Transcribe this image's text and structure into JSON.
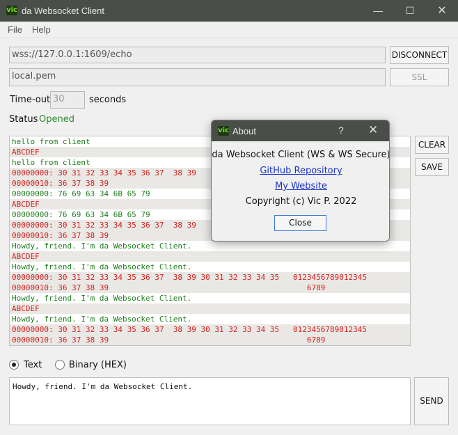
{
  "window": {
    "title": "da Websocket Client",
    "icon_text": "vic",
    "controls": {
      "minimize": "—",
      "maximize": "☐",
      "close": "✕"
    }
  },
  "menu": {
    "file": "File",
    "help": "Help"
  },
  "connection": {
    "url_value": "wss://127.0.0.1:1609/echo",
    "disconnect_label": "DISCONNECT",
    "cert_value": "local.pem",
    "ssl_label": "SSL",
    "timeout_label": "Time-out",
    "timeout_placeholder": "30",
    "seconds_label": "seconds",
    "status_label": "Status",
    "status_value": "Opened"
  },
  "log": [
    {
      "text": "hello from client",
      "kind": "green"
    },
    {
      "text": "ABCDEF",
      "kind": "red"
    },
    {
      "text": "hello from client",
      "kind": "green"
    },
    {
      "text": "00000000: 30 31 32 33 34 35 36 37  38 39",
      "kind": "red"
    },
    {
      "text": "00000010: 36 37 38 39",
      "kind": "red"
    },
    {
      "text": "00000000: 76 69 63 34 6B 65 79",
      "kind": "green"
    },
    {
      "text": "ABCDEF",
      "kind": "red"
    },
    {
      "text": "00000000: 76 69 63 34 6B 65 79",
      "kind": "green"
    },
    {
      "text": "00000000: 30 31 32 33 34 35 36 37  38 39",
      "kind": "red"
    },
    {
      "text": "00000010: 36 37 38 39",
      "kind": "red"
    },
    {
      "text": "Howdy, friend. I'm da Websocket Client.",
      "kind": "green"
    },
    {
      "text": "ABCDEF",
      "kind": "red"
    },
    {
      "text": "Howdy, friend. I'm da Websocket Client.",
      "kind": "green"
    },
    {
      "text": "00000000: 30 31 32 33 34 35 36 37  38 39 30 31 32 33 34 35   0123456789012345",
      "kind": "red"
    },
    {
      "text": "00000010: 36 37 38 39                                           6789",
      "kind": "red"
    },
    {
      "text": "Howdy, friend. I'm da Websocket Client.",
      "kind": "green"
    },
    {
      "text": "ABCDEF",
      "kind": "red"
    },
    {
      "text": "Howdy, friend. I'm da Websocket Client.",
      "kind": "green"
    },
    {
      "text": "00000000: 30 31 32 33 34 35 36 37  38 39 30 31 32 33 34 35   0123456789012345",
      "kind": "red"
    },
    {
      "text": "00000010: 36 37 38 39                                           6789",
      "kind": "red"
    }
  ],
  "log_buttons": {
    "clear": "CLEAR",
    "save": "SAVE"
  },
  "mode": {
    "text_label": "Text",
    "text_checked": true,
    "binary_label": "Binary (HEX)",
    "binary_checked": false
  },
  "message": {
    "value": "Howdy, friend. I'm da Websocket Client.",
    "send_label": "SEND"
  },
  "about": {
    "title": "About",
    "help": "?",
    "close_x": "✕",
    "app_line": "da Websocket Client (WS & WS Secure)",
    "github_link": "GitHub Repository",
    "website_link": "My Website",
    "copyright": "Copyright (c) Vic P. 2022",
    "close_label": "Close"
  },
  "colors": {
    "titlebar": "#4a4e48",
    "log_green": "#1d7f1d",
    "log_red": "#d42020",
    "status_green": "#2e8b2e",
    "link_blue": "#1a33c9"
  }
}
